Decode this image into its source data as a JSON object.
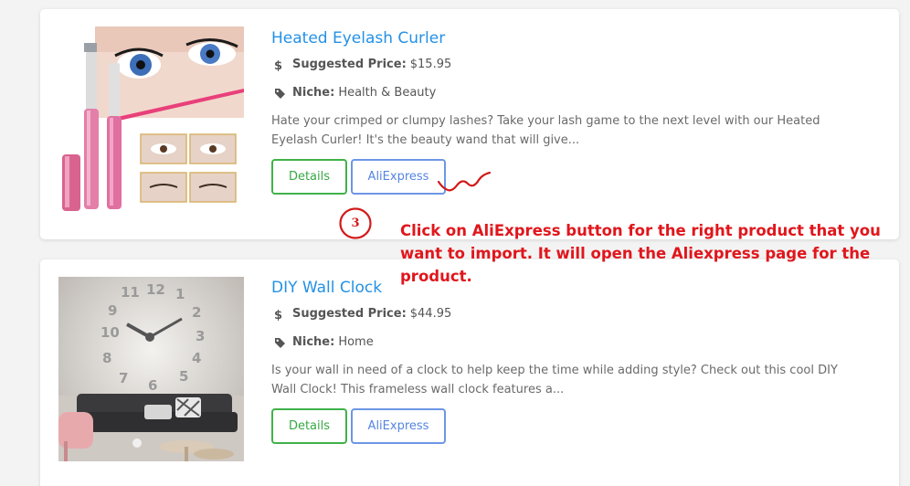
{
  "products": [
    {
      "title": "Heated Eyelash Curler",
      "price_label": "Suggested Price:",
      "price": "$15.95",
      "niche_label": "Niche:",
      "niche": "Health & Beauty",
      "description": "Hate your crimped or clumpy lashes? Take your lash game to the next level with our Heated Eyelash Curler! It's the beauty wand that will give...",
      "details_label": "Details",
      "aliexpress_label": "AliExpress",
      "image_icon": "eyelash-curler-product-image"
    },
    {
      "title": "DIY Wall Clock",
      "price_label": "Suggested Price:",
      "price": "$44.95",
      "niche_label": "Niche:",
      "niche": "Home",
      "description": "Is your wall in need of a clock to help keep the time while adding style? Check out this cool DIY Wall Clock! This frameless wall clock features a...",
      "details_label": "Details",
      "aliexpress_label": "AliExpress",
      "image_icon": "wall-clock-product-image"
    }
  ],
  "annotation": {
    "step_number": "3",
    "text": "Click on AliExpress button for the right product that you want to import. It will open the Aliexpress page for the product.",
    "color": "#e0161c"
  },
  "colors": {
    "title": "#2491e6",
    "details_border": "#3fb24a",
    "aliexpress_border": "#6d96e6",
    "background": "#f3f3f3"
  }
}
